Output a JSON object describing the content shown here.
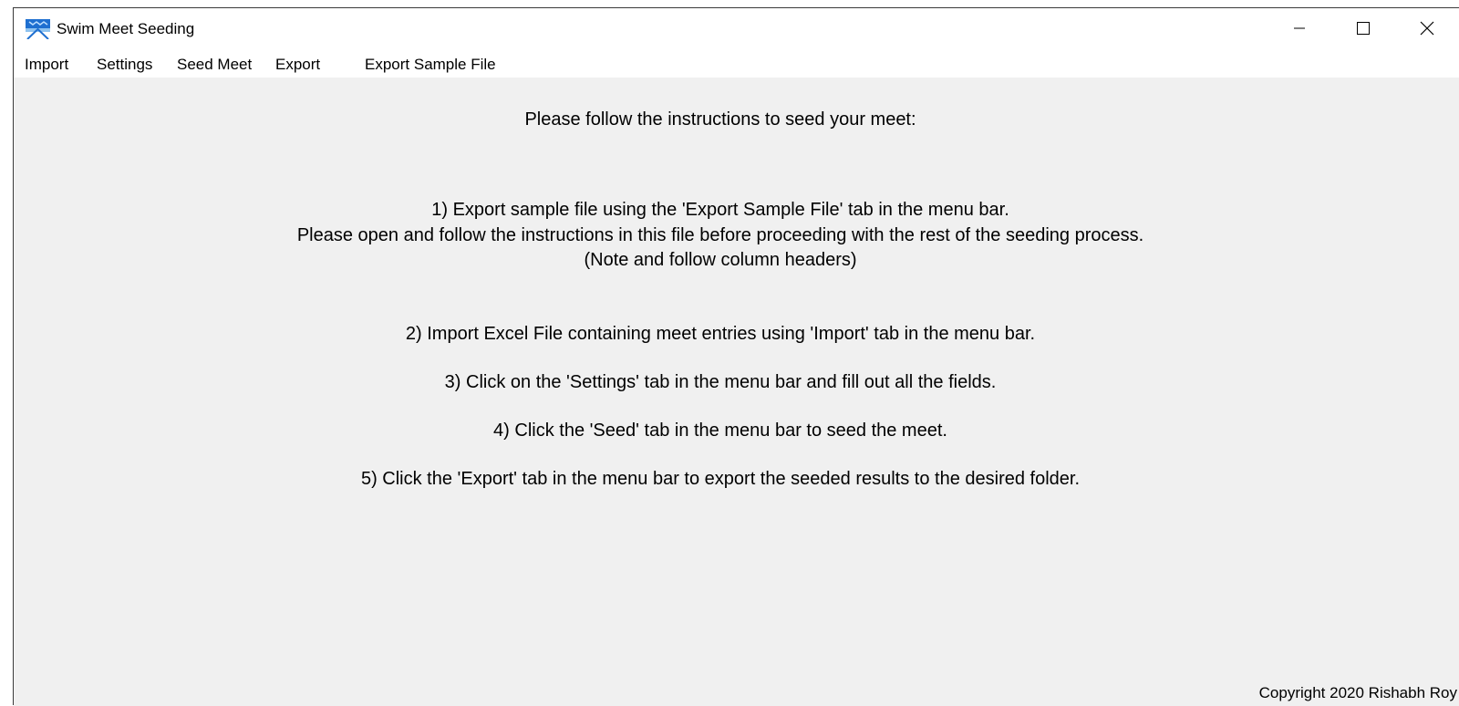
{
  "window": {
    "title": "Swim Meet Seeding",
    "icon": "swimmer-app-icon",
    "controls": [
      "minimize-icon",
      "maximize-icon",
      "close-icon"
    ]
  },
  "menu": {
    "import": "Import",
    "settings": "Settings",
    "seed_meet": "Seed Meet",
    "export": "Export",
    "export_sample": "Export Sample File"
  },
  "instructions": {
    "header": "Please follow the instructions to seed your meet:",
    "step1_line1": "1) Export sample file using the 'Export Sample File' tab in the menu bar.",
    "step1_line2": "Please open and follow the instructions in this file before proceeding with the rest of the seeding process.",
    "step1_line3": "(Note and follow column headers)",
    "step2": "2) Import Excel File containing meet entries using 'Import' tab in the menu bar.",
    "step3": "3) Click on the 'Settings' tab in the menu bar and fill out all the fields.",
    "step4": "4) Click the 'Seed' tab in the menu bar to seed the meet.",
    "step5": "5) Click the 'Export' tab in the menu bar to export the seeded results to the desired folder."
  },
  "footer": {
    "copyright": "Copyright 2020 Rishabh Roy"
  },
  "colors": {
    "window_bg": "#f0f0f0",
    "titlebar_bg": "#ffffff",
    "text": "#000000",
    "icon_blue": "#2a7fd4"
  }
}
